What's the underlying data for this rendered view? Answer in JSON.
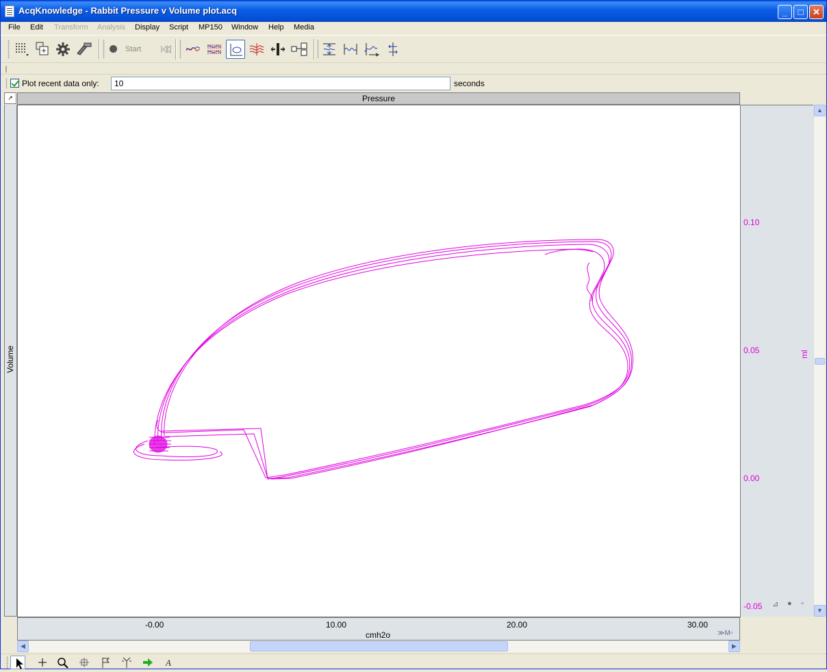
{
  "window": {
    "title": "AcqKnowledge - Rabbit Pressure v Volume plot.acq"
  },
  "menu": {
    "items": [
      {
        "label": "File",
        "enabled": true
      },
      {
        "label": "Edit",
        "enabled": true
      },
      {
        "label": "Transform",
        "enabled": false
      },
      {
        "label": "Analysis",
        "enabled": false
      },
      {
        "label": "Display",
        "enabled": true
      },
      {
        "label": "Script",
        "enabled": true
      },
      {
        "label": "MP150",
        "enabled": true
      },
      {
        "label": "Window",
        "enabled": true
      },
      {
        "label": "Help",
        "enabled": true
      },
      {
        "label": "Media",
        "enabled": true
      }
    ]
  },
  "toolbar": {
    "start_label": "Start"
  },
  "recent": {
    "label": "Plot recent data only:",
    "value": "10",
    "unit": "seconds",
    "checked": true
  },
  "plot": {
    "x_channel": "Pressure",
    "y_channel": "Volume",
    "x_unit": "cmh2o",
    "y_unit": "ml",
    "x_ticks": [
      "-0.00",
      "10.00",
      "20.00",
      "30.00"
    ],
    "y_ticks": [
      "0.10",
      "0.05",
      "0.00",
      "-0.05"
    ],
    "trace_color": "#e000e0"
  }
}
